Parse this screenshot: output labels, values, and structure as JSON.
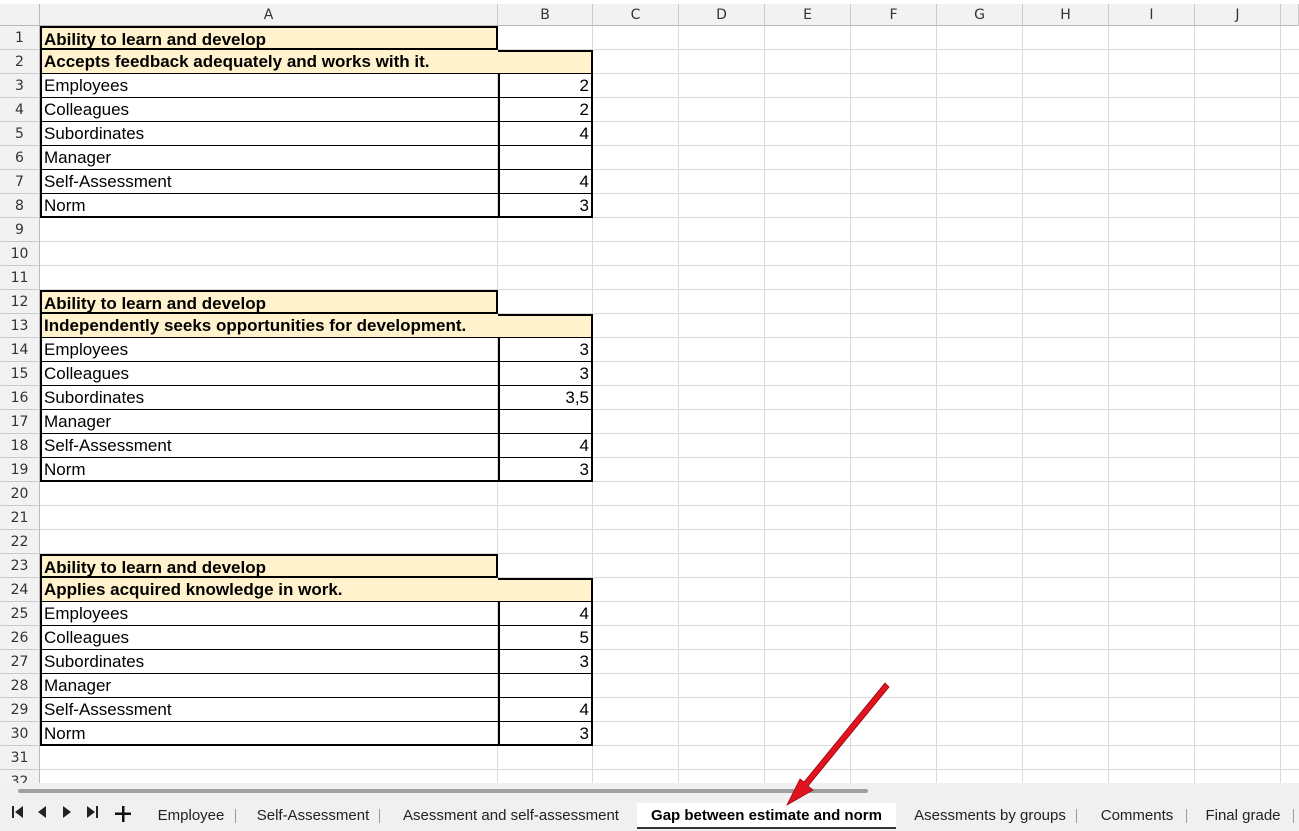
{
  "columns": [
    "A",
    "B",
    "C",
    "D",
    "E",
    "F",
    "G",
    "H",
    "I",
    "J"
  ],
  "rows": [
    "1",
    "2",
    "3",
    "4",
    "5",
    "6",
    "7",
    "8",
    "9",
    "10",
    "11",
    "12",
    "13",
    "14",
    "15",
    "16",
    "17",
    "18",
    "19",
    "20",
    "21",
    "22",
    "23",
    "24",
    "25",
    "26",
    "27",
    "28",
    "29",
    "30",
    "31",
    "32"
  ],
  "blocks": [
    {
      "category": "Ability to learn and develop",
      "criterion": "Accepts feedback adequately and works with it.",
      "items": [
        {
          "label": "Employees",
          "value": "2"
        },
        {
          "label": "Colleagues",
          "value": "2"
        },
        {
          "label": "Subordinates",
          "value": "4"
        },
        {
          "label": "Manager",
          "value": ""
        },
        {
          "label": "Self-Assessment",
          "value": "4"
        },
        {
          "label": "Norm",
          "value": "3"
        }
      ]
    },
    {
      "category": "Ability to learn and develop",
      "criterion": "Independently seeks opportunities for development.",
      "items": [
        {
          "label": "Employees",
          "value": "3"
        },
        {
          "label": "Colleagues",
          "value": "3"
        },
        {
          "label": "Subordinates",
          "value": "3,5"
        },
        {
          "label": "Manager",
          "value": ""
        },
        {
          "label": "Self-Assessment",
          "value": "4"
        },
        {
          "label": "Norm",
          "value": "3"
        }
      ]
    },
    {
      "category": "Ability to learn and develop",
      "criterion": "Applies acquired knowledge in work.",
      "items": [
        {
          "label": "Employees",
          "value": "4"
        },
        {
          "label": "Colleagues",
          "value": "5"
        },
        {
          "label": "Subordinates",
          "value": "3"
        },
        {
          "label": "Manager",
          "value": ""
        },
        {
          "label": "Self-Assessment",
          "value": "4"
        },
        {
          "label": "Norm",
          "value": "3"
        }
      ]
    }
  ],
  "nav": {
    "first": "first-sheet-icon",
    "prev": "previous-sheet-icon",
    "next": "next-sheet-icon",
    "last": "last-sheet-icon",
    "add": "add-sheet-icon"
  },
  "tabs": [
    {
      "label": "Employee",
      "active": false
    },
    {
      "label": "Self-Assessment",
      "active": false
    },
    {
      "label": "Asessment and self-assessment",
      "active": false
    },
    {
      "label": "Gap between estimate and norm",
      "active": true
    },
    {
      "label": "Asessments by groups",
      "active": false
    },
    {
      "label": "Comments",
      "active": false
    },
    {
      "label": "Final grade",
      "active": false
    }
  ],
  "colors": {
    "header_fill": "#fff2cc",
    "arrow": "#e0141e"
  }
}
